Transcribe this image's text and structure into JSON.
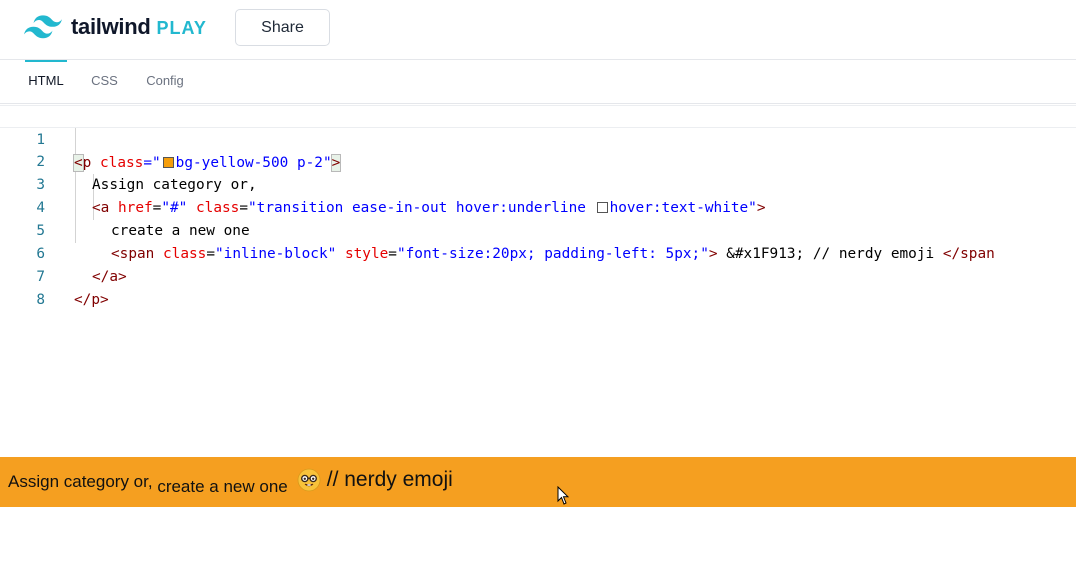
{
  "app": {
    "logo_text": "tailwind",
    "logo_suffix": "PLAY",
    "share_label": "Share",
    "accent_color": "#22b8cf"
  },
  "tabs": [
    {
      "label": "HTML",
      "active": true
    },
    {
      "label": "CSS",
      "active": false
    },
    {
      "label": "Config",
      "active": false
    }
  ],
  "editor": {
    "line_numbers": [
      "1",
      "2",
      "3",
      "4",
      "5",
      "6",
      "7",
      "8"
    ],
    "l1": {
      "lt": "<",
      "tag": "p",
      "attr": "class",
      "eq": "=\"",
      "val": "bg-yellow-500 p-2",
      "close": "\"",
      "gt": ">",
      "swatch_color": "#f59e0b"
    },
    "l2": {
      "text": "Assign category or,"
    },
    "l3": {
      "open": "<a",
      "attr1": "href",
      "val1": "\"#\"",
      "attr2": "class",
      "val2a": "\"transition ease-in-out hover:underline ",
      "val2b": "hover:text-white\"",
      "gt": ">",
      "swatch_color": "#ffffff"
    },
    "l4": {
      "text": "create a new one"
    },
    "l5": {
      "open": "<span",
      "attr1": "class",
      "val1": "\"inline-block\"",
      "attr2": "style",
      "val2": "\"font-size:20px; padding-left: 5px;\"",
      "gt": ">",
      "text": " &#x1F913; // nerdy emoji ",
      "close": "</span"
    },
    "l6": {
      "close": "</a>"
    },
    "l7": {
      "close": "</p>"
    }
  },
  "preview": {
    "text_before": "Assign category or, ",
    "link_text": "create a new one",
    "emoji_label": "// nerdy emoji",
    "bg_color": "#f59f20"
  }
}
